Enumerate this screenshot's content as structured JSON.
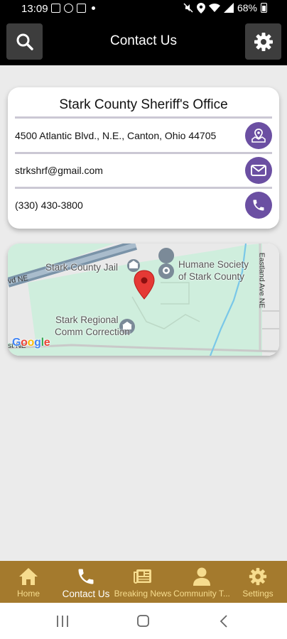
{
  "status_bar": {
    "time": "13:09",
    "battery": "68%"
  },
  "header": {
    "title": "Contact Us"
  },
  "contact": {
    "name": "Stark County Sheriff's Office",
    "address": "4500 Atlantic Blvd., N.E., Canton, Ohio 44705",
    "email": "strkshrf@gmail.com",
    "phone": "(330) 430-3800"
  },
  "map": {
    "labels": {
      "jail": "Stark County Jail",
      "humane_line1": "Humane Society",
      "humane_line2": "of Stark County",
      "regional_line1": "Stark Regional",
      "regional_line2": "Comm Correction",
      "road_left": "vd NE",
      "road_right": "Eastland Ave NE",
      "road_bottom": "st NE"
    },
    "provider": "Google"
  },
  "bottom_nav": {
    "items": [
      {
        "label": "Home",
        "icon": "home-icon",
        "active": false
      },
      {
        "label": "Contact Us",
        "icon": "phone-icon",
        "active": true
      },
      {
        "label": "Breaking News",
        "icon": "newspaper-icon",
        "active": false
      },
      {
        "label": "Community T...",
        "icon": "person-icon",
        "active": false
      },
      {
        "label": "Settings",
        "icon": "gear-icon",
        "active": false
      }
    ]
  },
  "colors": {
    "accent_purple": "#6b4fa2",
    "nav_gold": "#a47a2d",
    "nav_label": "#f6dc8e",
    "app_bar": "#000000"
  }
}
